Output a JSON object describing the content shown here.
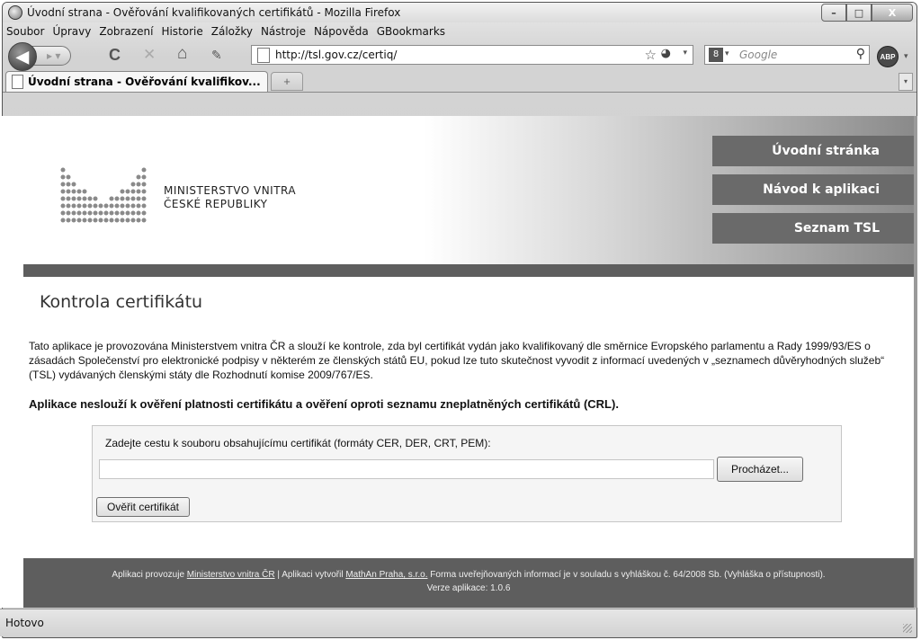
{
  "window": {
    "title": "Úvodní strana - Ověřování kvalifikovaných certifikátů - Mozilla Firefox",
    "buttons": {
      "minimize": "–",
      "maximize": "□",
      "close": "X"
    }
  },
  "menu": {
    "items": [
      "Soubor",
      "Úpravy",
      "Zobrazení",
      "Historie",
      "Záložky",
      "Nástroje",
      "Nápověda",
      "GBookmarks"
    ]
  },
  "toolbar": {
    "back_icon": "◀",
    "forward_icon": "▸ ▾",
    "reload_icon": "C",
    "stop_icon": "✕",
    "home_icon": "⌂",
    "addon_icon": "✎",
    "url": "http://tsl.gov.cz/certiq/",
    "bookmark_star": "☆",
    "rss_icon": "◕",
    "url_dropdown": "▾",
    "search_placeholder": "Google",
    "search_engine_icon": "8",
    "search_dropdown": "▾",
    "search_icon": "⚲",
    "abp_label": "ABP",
    "abp_dropdown": "▾"
  },
  "tabs": {
    "active_tab": "Úvodní strana - Ověřování kvalifikov...",
    "close_icon": "✕",
    "new_tab": "+",
    "list_dropdown": "▾"
  },
  "header": {
    "logo_line1": "MINISTERSTVO VNITRA",
    "logo_line2": "ČESKÉ REPUBLIKY",
    "nav": [
      "Úvodní stránka",
      "Návod k aplikaci",
      "Seznam TSL"
    ]
  },
  "main": {
    "title": "Kontrola certifikátu",
    "intro": "Tato aplikace je provozována Ministerstvem vnitra ČR a slouží ke kontrole, zda byl certifikát vydán jako kvalifikovaný dle směrnice Evropského parlamentu a Rady 1999/93/ES o zásadách Společenství pro elektronické podpisy v některém ze členských států EU, pokud lze tuto skutečnost vyvodit z informací uvedených v „seznamech důvěryhodných služeb“ (TSL) vydávaných členskými státy dle Rozhodnutí komise 2009/767/ES.",
    "warning": "Aplikace neslouží k ověření platnosti certifikátu a ověření oproti seznamu zneplatněných certifikátů (CRL).",
    "form": {
      "label": "Zadejte cestu k souboru obsahujícímu certifikát (formáty CER, DER, CRT, PEM):",
      "file_value": "",
      "browse_label": "Procházet...",
      "submit_label": "Ověřit certifikát"
    }
  },
  "footer": {
    "line1_prefix": "Aplikaci provozuje ",
    "operator_link": "Ministerstvo vnitra ČR",
    "line1_mid": " | Aplikaci vytvořil ",
    "creator_link": "MathAn Praha, s.r.o.",
    "line1_suffix": " Forma uveřejňovaných informací je v souladu s vyhláškou č. 64/2008 Sb. (Vyhláška o přístupnosti).",
    "version": "Verze aplikace: 1.0.6"
  },
  "status": {
    "text": "Hotovo"
  },
  "colors": {
    "nav_button": "#6a6a6a",
    "band": "#5e5e5e",
    "form_bg": "#f5f5f5"
  }
}
